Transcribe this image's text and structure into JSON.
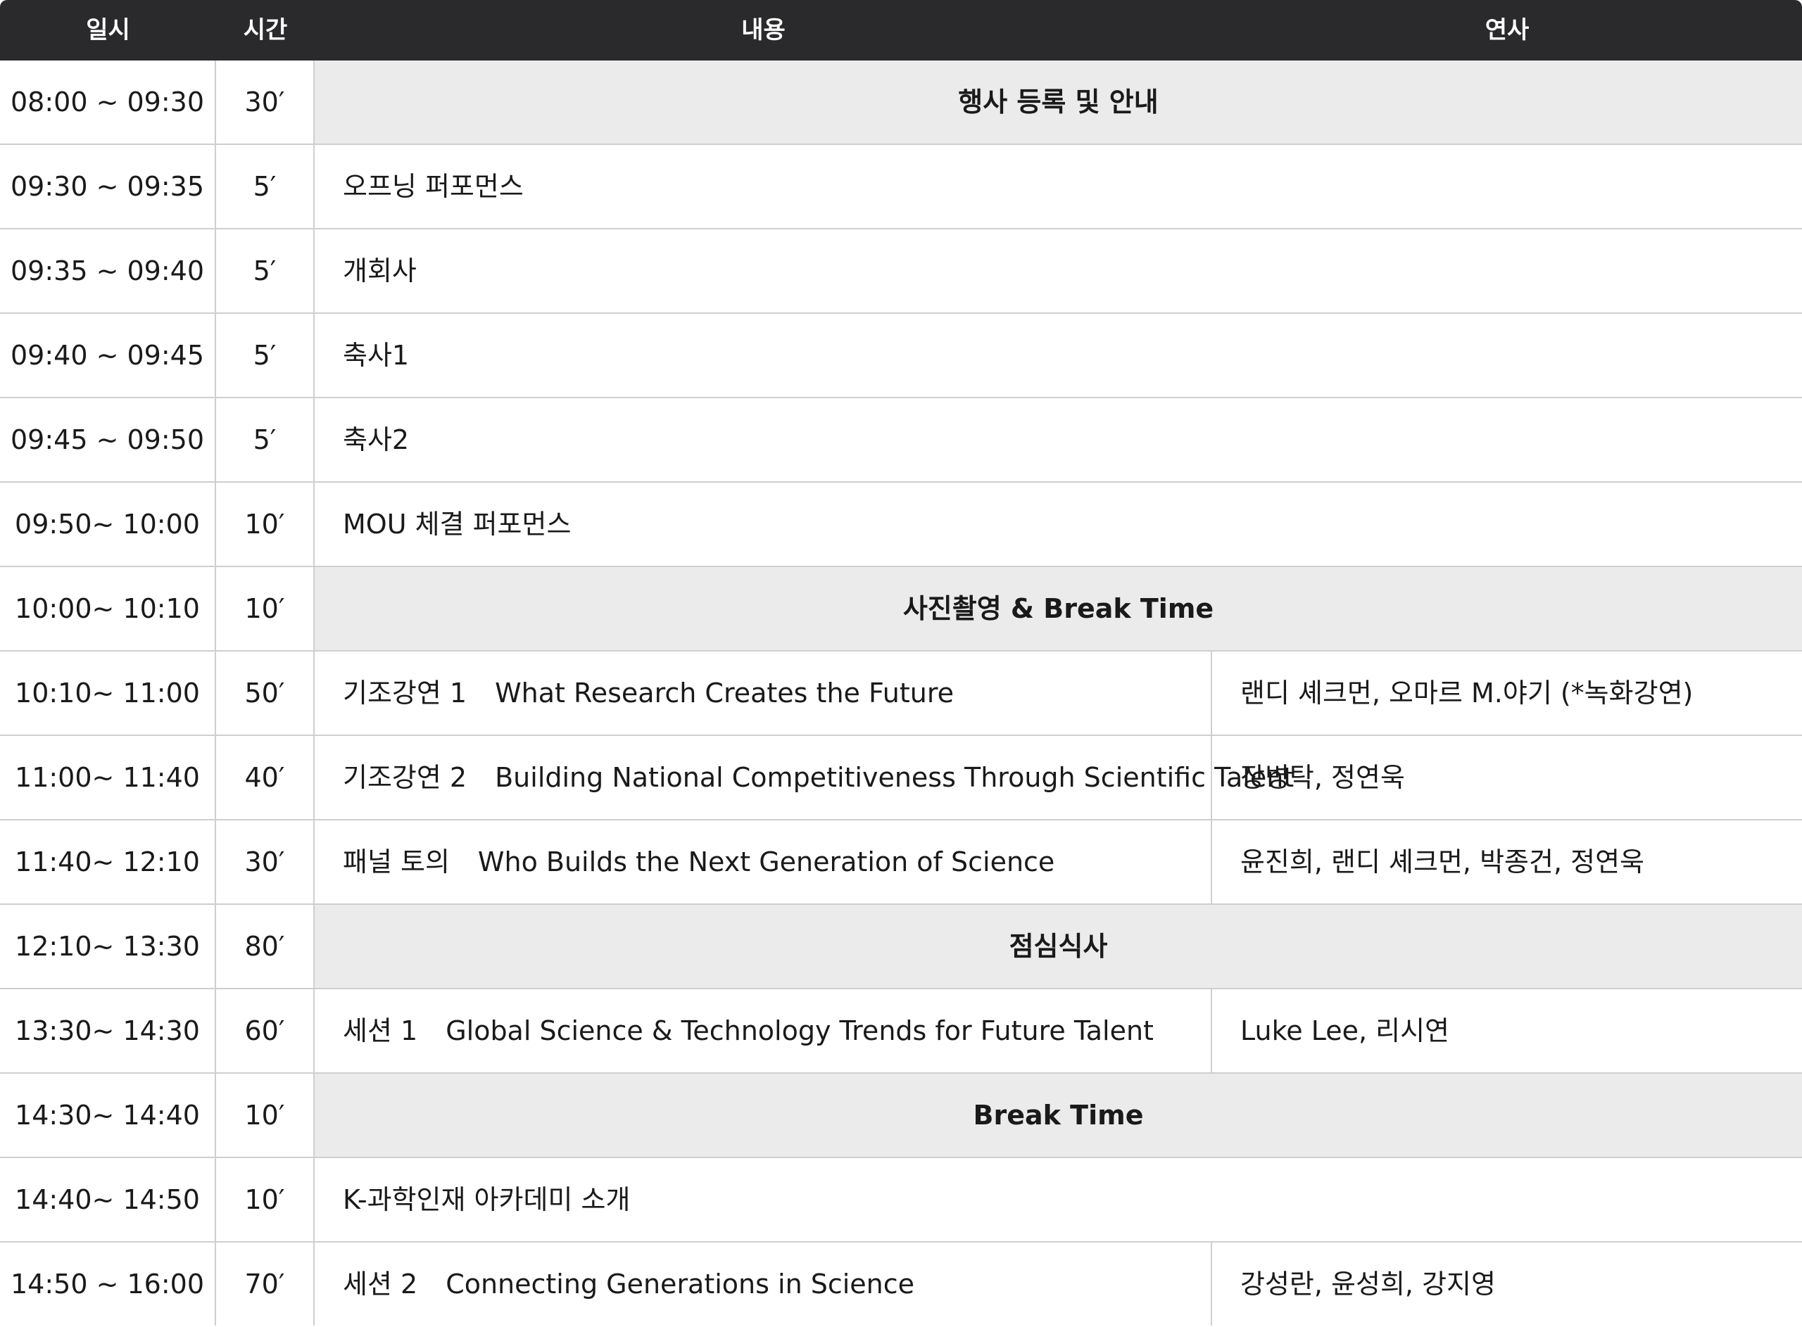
{
  "header": {
    "datetime": "일시",
    "duration": "시간",
    "content": "내용",
    "speaker": "연사"
  },
  "rows": [
    {
      "time": "08:00 ~ 09:30",
      "duration": "30′",
      "banner": "행사 등록 및 안내"
    },
    {
      "time": "09:30 ~  09:35",
      "duration": "5′",
      "content": "오프닝 퍼포먼스"
    },
    {
      "time": "09:35 ~  09:40",
      "duration": "5′",
      "content": "개회사"
    },
    {
      "time": "09:40 ~  09:45",
      "duration": "5′",
      "content": "축사1"
    },
    {
      "time": "09:45 ~  09:50",
      "duration": "5′",
      "content": "축사2"
    },
    {
      "time": "09:50~ 10:00",
      "duration": "10′",
      "content": "MOU 체결 퍼포먼스"
    },
    {
      "time": "10:00~ 10:10",
      "duration": "10′",
      "banner": "사진촬영 & Break Time"
    },
    {
      "time": "10:10~ 11:00",
      "duration": "50′",
      "tag": "기조강연 1",
      "content": "What Research Creates the Future",
      "speaker": "랜디 셰크먼, 오마르 M.야기 (*녹화강연)"
    },
    {
      "time": "11:00~ 11:40",
      "duration": "40′",
      "tag": "기조강연 2",
      "content": "Building National Competitiveness Through Scientific Talent",
      "speaker": "장병탁, 정연욱"
    },
    {
      "time": "11:40~ 12:10",
      "duration": "30′",
      "tag": "패널 토의",
      "content": "Who Builds the Next Generation of Science",
      "speaker": "윤진희, 랜디 셰크먼, 박종건, 정연욱"
    },
    {
      "time": "12:10~ 13:30",
      "duration": "80′",
      "banner": "점심식사"
    },
    {
      "time": "13:30~ 14:30",
      "duration": "60′",
      "tag": "세션 1",
      "content": "Global Science & Technology Trends for Future Talent",
      "speaker": "Luke Lee, 리시연"
    },
    {
      "time": "14:30~ 14:40",
      "duration": "10′",
      "banner": "Break Time"
    },
    {
      "time": "14:40~ 14:50",
      "duration": "10′",
      "content": "K-과학인재 아카데미 소개"
    },
    {
      "time": "14:50 ~ 16:00",
      "duration": "70′",
      "tag": "세션 2",
      "content": "Connecting Generations in Science",
      "speaker": "강성란, 윤성희, 강지영"
    }
  ]
}
